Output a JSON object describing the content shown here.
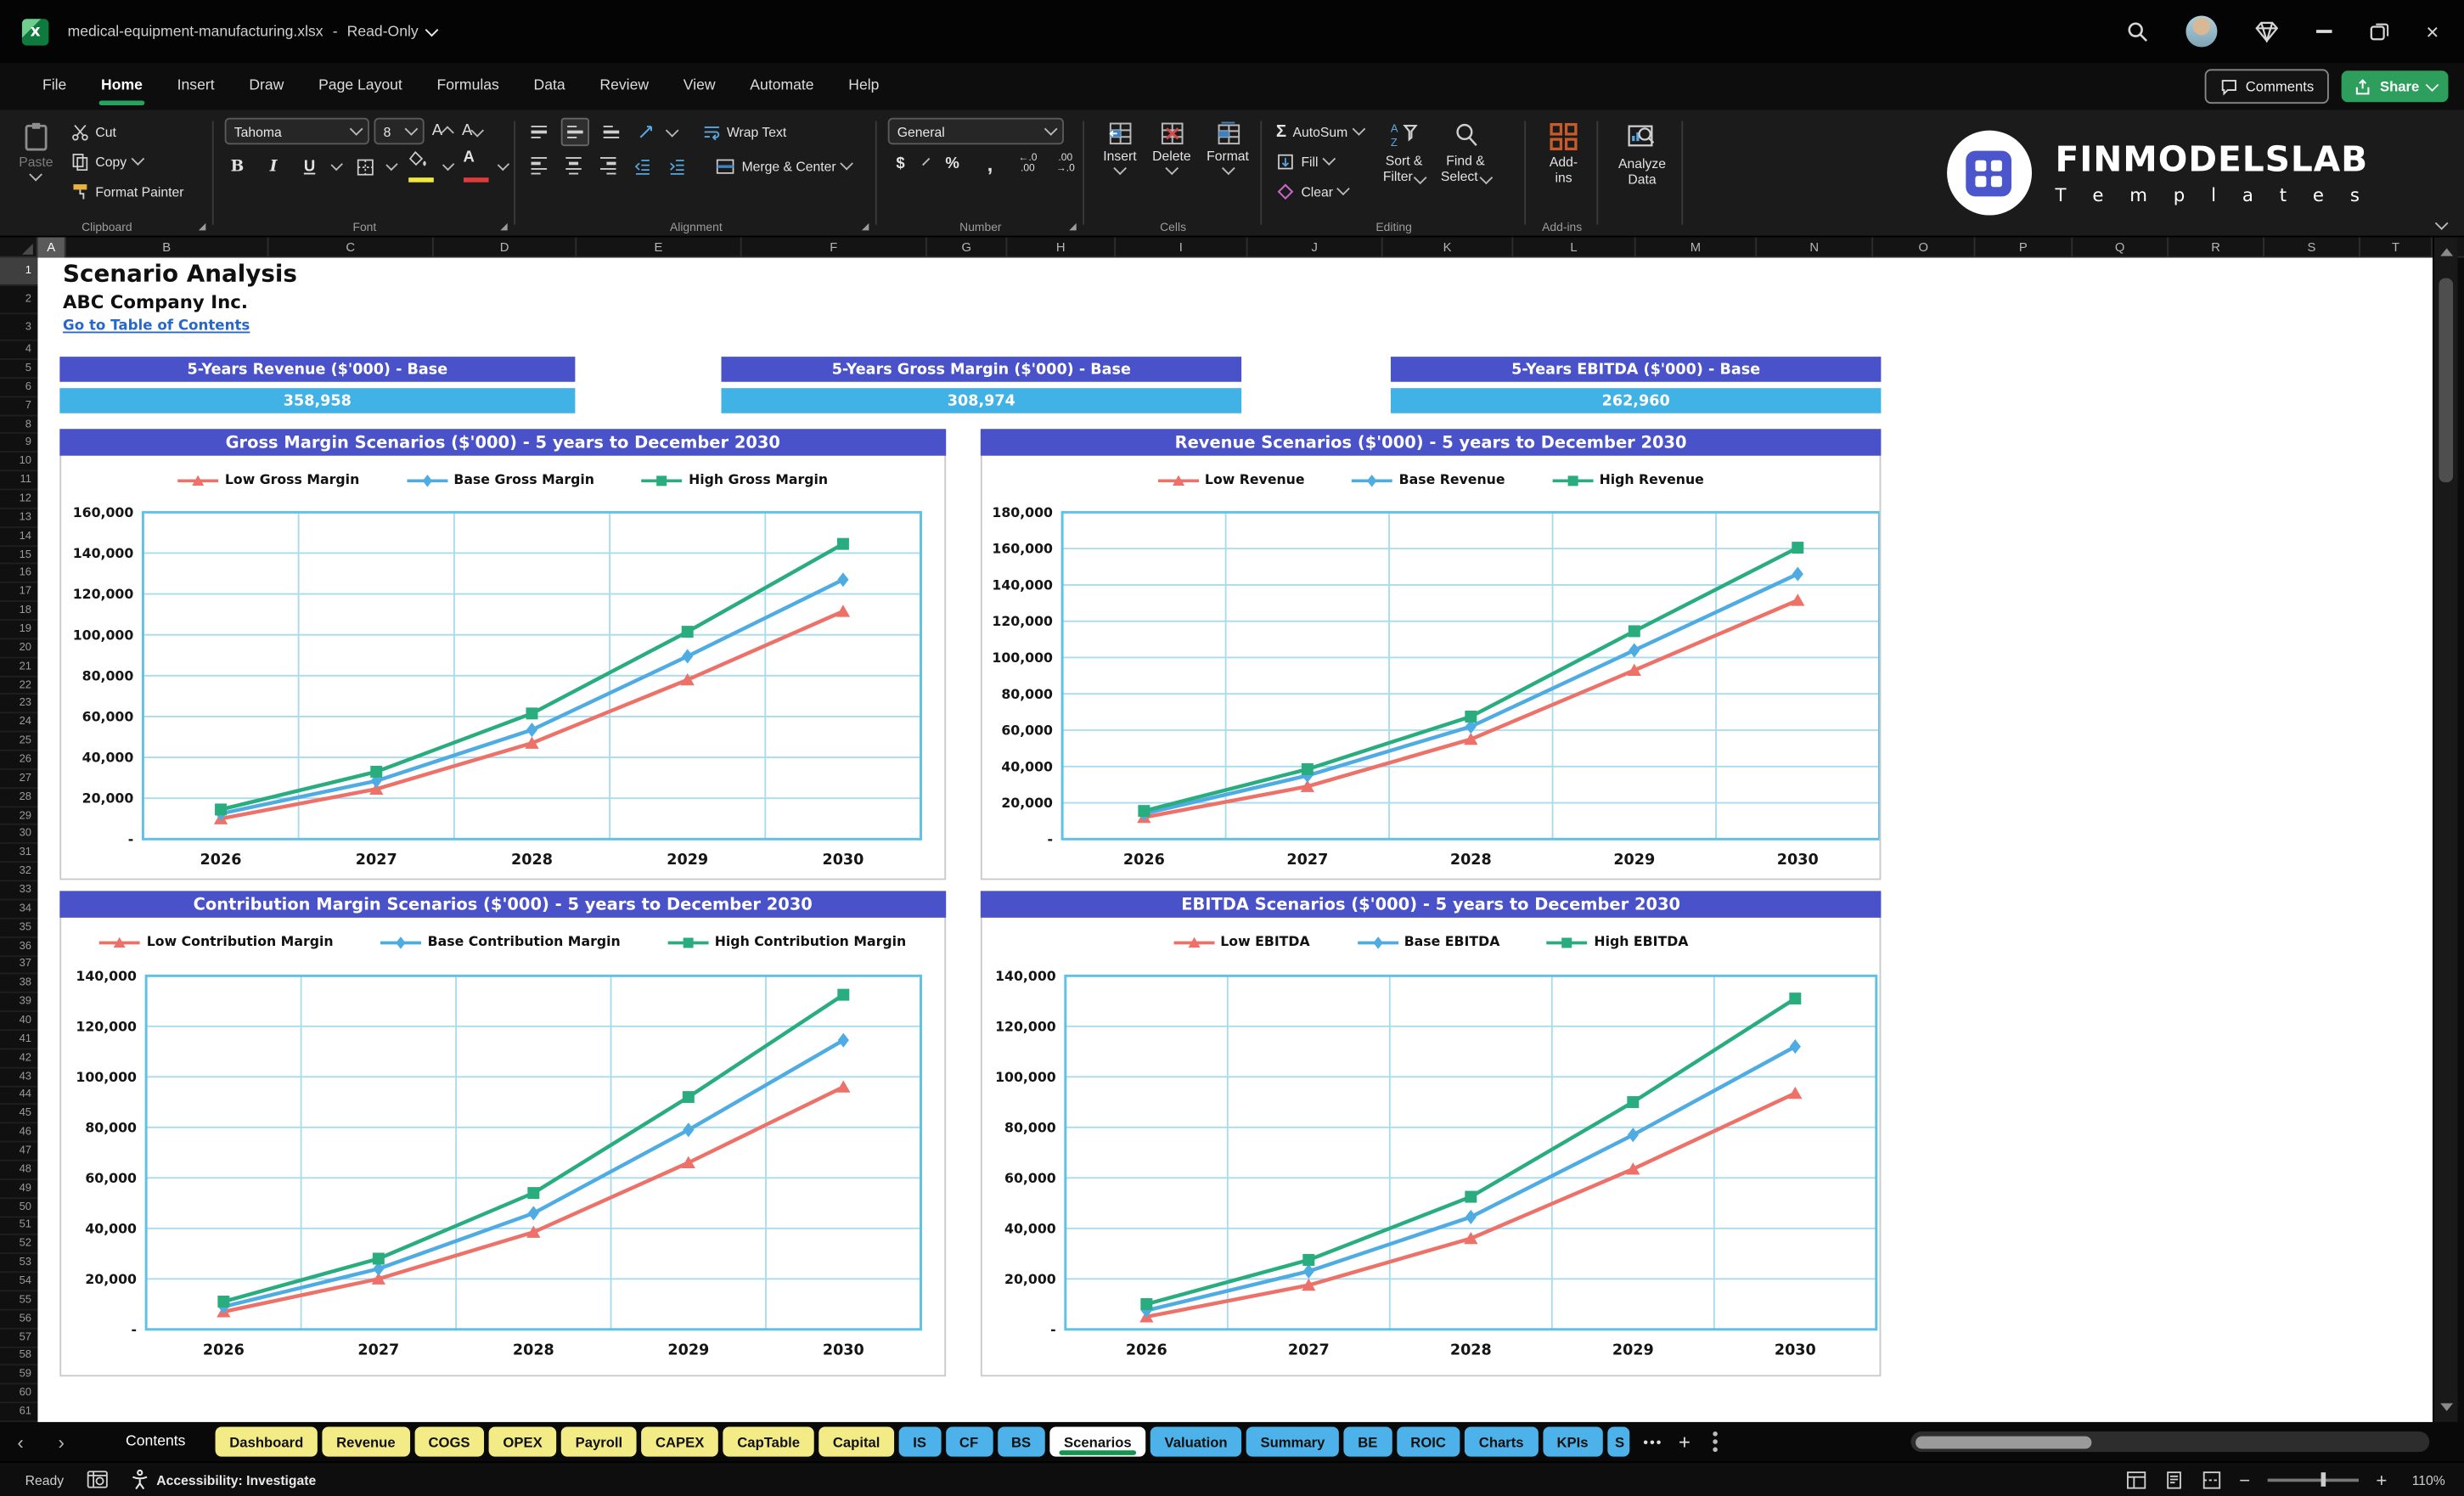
{
  "titlebar": {
    "filename": "medical-equipment-manufacturing.xlsx",
    "separator": "-",
    "mode": "Read-Only"
  },
  "menu": {
    "items": [
      "File",
      "Home",
      "Insert",
      "Draw",
      "Page Layout",
      "Formulas",
      "Data",
      "Review",
      "View",
      "Automate",
      "Help"
    ],
    "active": "Home",
    "comments": "Comments",
    "share": "Share"
  },
  "ribbon": {
    "clipboard": {
      "paste": "Paste",
      "cut": "Cut",
      "copy": "Copy",
      "format_painter": "Format Painter",
      "group": "Clipboard"
    },
    "font": {
      "font_name": "Tahoma",
      "font_size": "8",
      "bold": "B",
      "italic": "I",
      "underline": "U",
      "group": "Font"
    },
    "alignment": {
      "wrap_text": "Wrap Text",
      "merge_center": "Merge & Center",
      "group": "Alignment"
    },
    "number": {
      "format": "General",
      "currency": "$",
      "percent": "%",
      "comma": ",",
      "group": "Number"
    },
    "cells": {
      "insert": "Insert",
      "delete": "Delete",
      "format": "Format",
      "group": "Cells"
    },
    "editing": {
      "autosum": "AutoSum",
      "autosum_symbol": "Σ",
      "fill": "Fill",
      "clear": "Clear",
      "sort1": "Sort &",
      "sort2": "Filter",
      "find1": "Find &",
      "find2": "Select",
      "group": "Editing"
    },
    "addins": {
      "button": "Add-ins",
      "group": "Add-ins"
    },
    "analyze": {
      "line1": "Analyze",
      "line2": "Data"
    },
    "logo": {
      "brand": "FINMODELSLAB",
      "sub": "T e m p l a t e s"
    }
  },
  "sheet": {
    "columns": [
      "A",
      "B",
      "C",
      "D",
      "E",
      "F",
      "G",
      "H",
      "I",
      "J",
      "K",
      "L",
      "M",
      "N",
      "O",
      "P",
      "Q",
      "R",
      "S",
      "T"
    ],
    "row_count": 61,
    "title": "Scenario Analysis",
    "company": "ABC Company Inc.",
    "link": "Go to Table of Contents",
    "kpis": [
      {
        "label": "5-Years Revenue ($'000) - Base",
        "value": "358,958"
      },
      {
        "label": "5-Years Gross Margin ($'000) - Base",
        "value": "308,974"
      },
      {
        "label": "5-Years EBITDA ($'000) - Base",
        "value": "262,960"
      }
    ]
  },
  "chart_data": [
    {
      "type": "line",
      "title": "Gross Margin Scenarios ($'000) - 5 years to December 2030",
      "categories": [
        "2026",
        "2027",
        "2028",
        "2029",
        "2030"
      ],
      "ylim": [
        0,
        160000
      ],
      "ytick_step": 20000,
      "grid": true,
      "legend_position": "top",
      "series": [
        {
          "name": "Low Gross Margin",
          "color": "#ED7168",
          "marker": "triangle",
          "values": [
            10000,
            24500,
            47000,
            78000,
            111500
          ]
        },
        {
          "name": "Base Gross Margin",
          "color": "#4FACE3",
          "marker": "diamond",
          "values": [
            12500,
            28500,
            53500,
            89500,
            127000
          ]
        },
        {
          "name": "High Gross Margin",
          "color": "#29AD7F",
          "marker": "square",
          "values": [
            14500,
            33000,
            61500,
            101500,
            144500
          ]
        }
      ]
    },
    {
      "type": "line",
      "title": "Revenue Scenarios ($'000) - 5 years to December 2030",
      "categories": [
        "2026",
        "2027",
        "2028",
        "2029",
        "2030"
      ],
      "ylim": [
        0,
        180000
      ],
      "ytick_step": 20000,
      "grid": true,
      "legend_position": "top",
      "series": [
        {
          "name": "Low Revenue",
          "color": "#ED7168",
          "marker": "triangle",
          "values": [
            12000,
            29000,
            55000,
            93000,
            131500
          ]
        },
        {
          "name": "Base Revenue",
          "color": "#4FACE3",
          "marker": "diamond",
          "values": [
            14000,
            35000,
            62000,
            104000,
            146000
          ]
        },
        {
          "name": "High Revenue",
          "color": "#29AD7F",
          "marker": "square",
          "values": [
            15500,
            38500,
            67500,
            114500,
            160500
          ]
        }
      ]
    },
    {
      "type": "line",
      "title": "Contribution Margin Scenarios ($'000) - 5 years to December 2030",
      "categories": [
        "2026",
        "2027",
        "2028",
        "2029",
        "2030"
      ],
      "ylim": [
        0,
        140000
      ],
      "ytick_step": 20000,
      "grid": true,
      "legend_position": "top",
      "series": [
        {
          "name": "Low Contribution Margin",
          "color": "#ED7168",
          "marker": "triangle",
          "values": [
            7000,
            20000,
            38500,
            66000,
            96000
          ]
        },
        {
          "name": "Base Contribution Margin",
          "color": "#4FACE3",
          "marker": "diamond",
          "values": [
            9000,
            24000,
            46000,
            79000,
            114500
          ]
        },
        {
          "name": "High Contribution Margin",
          "color": "#29AD7F",
          "marker": "square",
          "values": [
            11000,
            28000,
            54000,
            92000,
            132500
          ]
        }
      ]
    },
    {
      "type": "line",
      "title": "EBITDA Scenarios ($'000) - 5 years to December 2030",
      "categories": [
        "2026",
        "2027",
        "2028",
        "2029",
        "2030"
      ],
      "ylim": [
        0,
        140000
      ],
      "ytick_step": 20000,
      "grid": true,
      "legend_position": "top",
      "series": [
        {
          "name": "Low EBITDA",
          "color": "#ED7168",
          "marker": "triangle",
          "values": [
            5000,
            17500,
            36000,
            63500,
            93500
          ]
        },
        {
          "name": "Base EBITDA",
          "color": "#4FACE3",
          "marker": "diamond",
          "values": [
            7500,
            23000,
            44500,
            77000,
            112000
          ]
        },
        {
          "name": "High EBITDA",
          "color": "#29AD7F",
          "marker": "square",
          "values": [
            10000,
            27500,
            52500,
            90000,
            131000
          ]
        }
      ]
    }
  ],
  "tabs": {
    "sheets": [
      {
        "label": "Contents",
        "style": "plain"
      },
      {
        "label": "Dashboard",
        "style": "yellow"
      },
      {
        "label": "Revenue",
        "style": "yellow"
      },
      {
        "label": "COGS",
        "style": "yellow"
      },
      {
        "label": "OPEX",
        "style": "yellow"
      },
      {
        "label": "Payroll",
        "style": "yellow"
      },
      {
        "label": "CAPEX",
        "style": "yellow"
      },
      {
        "label": "CapTable",
        "style": "yellow"
      },
      {
        "label": "Capital",
        "style": "yellow"
      },
      {
        "label": "IS",
        "style": "blue"
      },
      {
        "label": "CF",
        "style": "blue"
      },
      {
        "label": "BS",
        "style": "blue"
      },
      {
        "label": "Scenarios",
        "style": "active"
      },
      {
        "label": "Valuation",
        "style": "blue"
      },
      {
        "label": "Summary",
        "style": "blue"
      },
      {
        "label": "BE",
        "style": "blue"
      },
      {
        "label": "ROIC",
        "style": "blue"
      },
      {
        "label": "Charts",
        "style": "blue"
      },
      {
        "label": "KPIs",
        "style": "blue"
      },
      {
        "label": "S",
        "style": "blue",
        "cut": true
      }
    ]
  },
  "statusbar": {
    "ready": "Ready",
    "accessibility": "Accessibility: Investigate",
    "zoom": "110%"
  },
  "colors": {
    "header_blue": "#4A52C9",
    "value_cyan": "#41B2E5",
    "tab_yellow": "#F3EC86",
    "tab_blue": "#4CB2E9",
    "active_green": "#17934F",
    "series_low": "#ED7168",
    "series_base": "#4FACE3",
    "series_high": "#29AD7F",
    "chart_grid": "#A9DBEE",
    "chart_border": "#5EC1E6"
  }
}
